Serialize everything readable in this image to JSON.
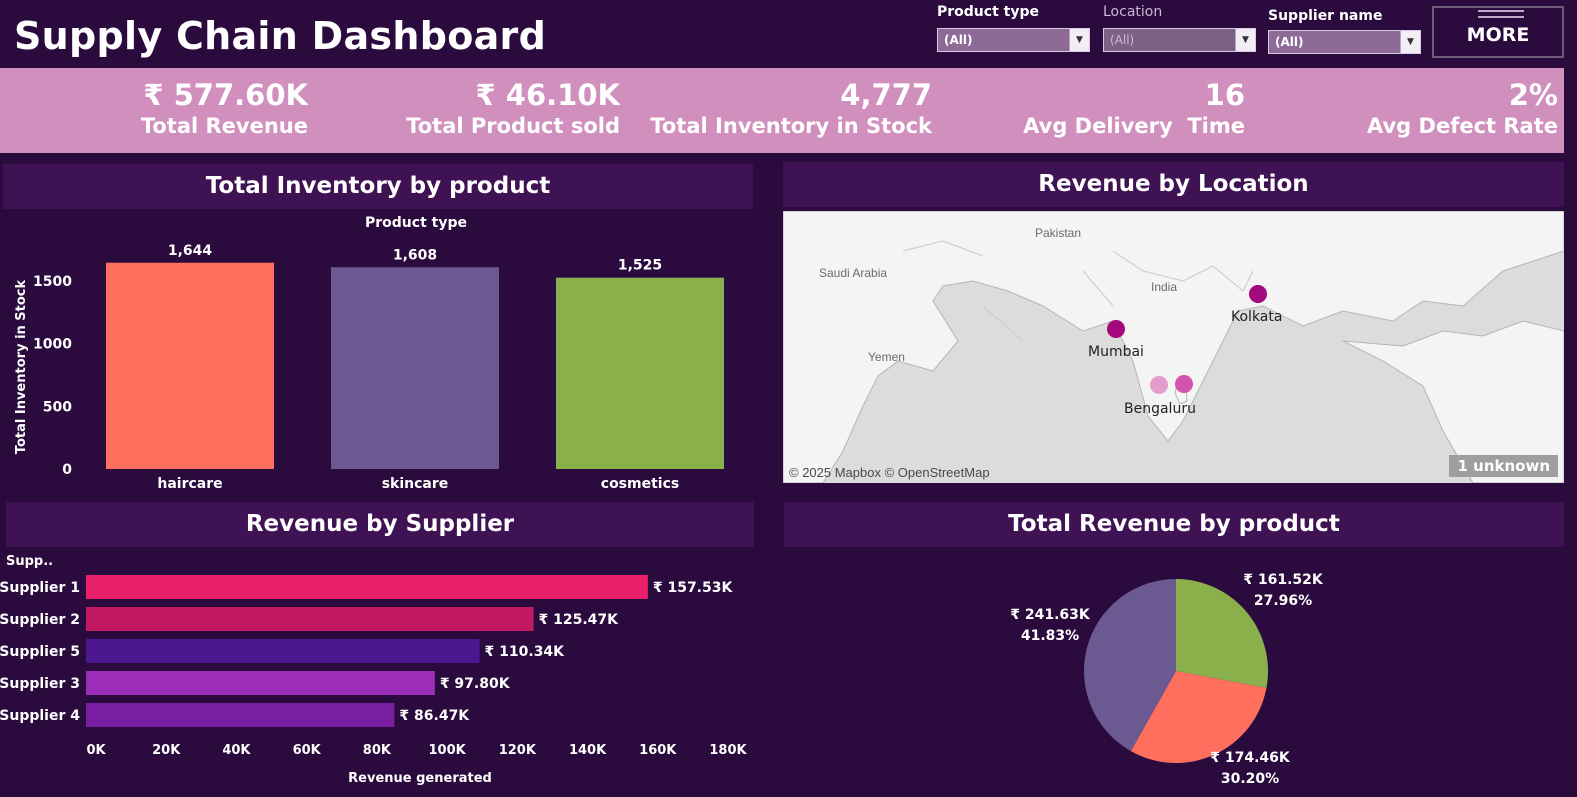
{
  "header": {
    "title": "Supply Chain Dashboard",
    "more_label": "MORE"
  },
  "filters": [
    {
      "label": "Product type",
      "value": "(All)"
    },
    {
      "label": "Location",
      "value": "(All)"
    },
    {
      "label": "Supplier name",
      "value": "(All)"
    }
  ],
  "kpis": [
    {
      "value": "₹ 577.60K",
      "label": "Total Revenue"
    },
    {
      "value": "₹ 46.10K",
      "label": "Total Product sold"
    },
    {
      "value": "4,777",
      "label": "Total Inventory in Stock"
    },
    {
      "value": "16",
      "label": "Avg Delivery  Time"
    },
    {
      "value": "2%",
      "label": "Avg Defect Rate"
    }
  ],
  "panels": {
    "inventory_title": "Total Inventory by product",
    "location_title": "Revenue by Location",
    "supplier_title": "Revenue by Supplier",
    "revenue_product_title": "Total Revenue by product"
  },
  "map": {
    "country_labels": [
      "Pakistan",
      "Saudi Arabia",
      "India",
      "Yemen"
    ],
    "cities": [
      "Kolkata",
      "Mumbai",
      "Bengaluru"
    ],
    "credit": "© 2025 Mapbox © OpenStreetMap",
    "unknown": "1 unknown"
  },
  "chart_data": [
    {
      "type": "bar",
      "title": "Total Inventory by product",
      "xlabel": "Product type",
      "ylabel": "Total Inventory in Stock",
      "categories": [
        "haircare",
        "skincare",
        "cosmetics"
      ],
      "values": [
        1644,
        1608,
        1525
      ],
      "data_labels": [
        "1,644",
        "1,608",
        "1,525"
      ],
      "colors": [
        "#ff6f5e",
        "#6a5a91",
        "#8ab04c"
      ],
      "yticks": [
        "0",
        "500",
        "1000",
        "1500"
      ],
      "ylim": [
        0,
        1650
      ]
    },
    {
      "type": "bar",
      "orientation": "horizontal",
      "title": "Revenue by Supplier",
      "ylabel": "Supp..",
      "xlabel": "Revenue generated",
      "categories": [
        "Supplier 1",
        "Supplier 2",
        "Supplier 5",
        "Supplier 3",
        "Supplier 4"
      ],
      "values": [
        157530,
        125470,
        110340,
        97800,
        86470
      ],
      "data_labels": [
        "₹ 157.53K",
        "₹ 125.47K",
        "₹ 110.34K",
        "₹ 97.80K",
        "₹ 86.47K"
      ],
      "colors": [
        "#e8206a",
        "#c21a62",
        "#4c1890",
        "#9b2db8",
        "#7a1fa2"
      ],
      "xticks": [
        "0K",
        "20K",
        "40K",
        "60K",
        "80K",
        "100K",
        "120K",
        "140K",
        "160K",
        "180K"
      ],
      "xlim": [
        0,
        180000
      ]
    },
    {
      "type": "pie",
      "title": "Total Revenue by product",
      "slices": [
        {
          "value": 161520,
          "label": "₹ 161.52K",
          "pct": "27.96%",
          "color": "#8ab04c"
        },
        {
          "value": 174460,
          "label": "₹ 174.46K",
          "pct": "30.20%",
          "color": "#ff6f5e"
        },
        {
          "value": 241630,
          "label": "₹ 241.63K",
          "pct": "41.83%",
          "color": "#6a5a91"
        }
      ]
    }
  ]
}
